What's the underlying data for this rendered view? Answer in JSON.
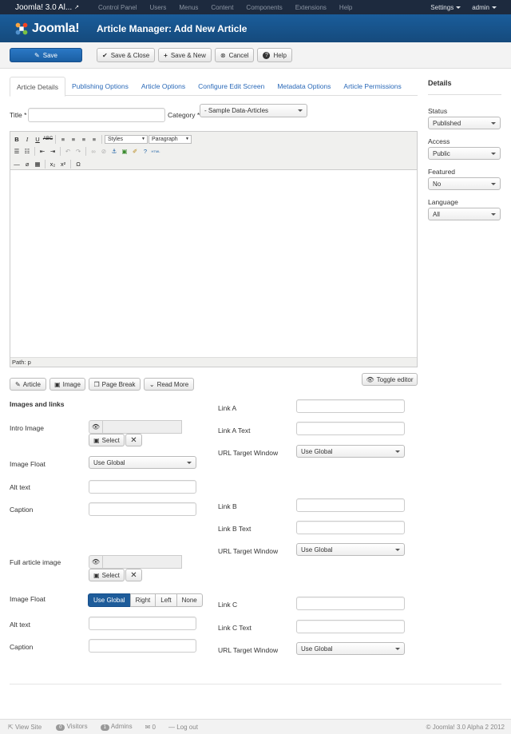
{
  "topbar": {
    "site_name": "Joomla! 3.0 Al...",
    "nav": [
      "Control Panel",
      "Users",
      "Menus",
      "Content",
      "Components",
      "Extensions",
      "Help"
    ],
    "settings": "Settings",
    "user": "admin"
  },
  "header": {
    "logo_text": "Joomla!",
    "title": "Article Manager: Add New Article"
  },
  "toolbar": {
    "save": "Save",
    "save_close": "Save & Close",
    "save_new": "Save & New",
    "cancel": "Cancel",
    "help": "Help"
  },
  "tabs": [
    "Article Details",
    "Publishing Options",
    "Article Options",
    "Configure Edit Screen",
    "Metadata Options",
    "Article Permissions"
  ],
  "form": {
    "title_label": "Title *",
    "title_value": "",
    "category_label": "Category *",
    "category_value": "- Sample Data-Articles"
  },
  "editor": {
    "styles": "Styles",
    "paragraph": "Paragraph",
    "path": "Path: p"
  },
  "editor_buttons": {
    "article": "Article",
    "image": "Image",
    "page_break": "Page Break",
    "read_more": "Read More",
    "toggle": "Toggle editor"
  },
  "images": {
    "section_title": "Images and links",
    "intro_image": "Intro Image",
    "select": "Select",
    "image_float": "Image Float",
    "float_value": "Use Global",
    "alt_text": "Alt text",
    "caption": "Caption",
    "full_image": "Full article image",
    "float_options": [
      "Use Global",
      "Right",
      "Left",
      "None"
    ]
  },
  "links": {
    "link_a": "Link A",
    "link_a_text": "Link A Text",
    "url_target": "URL Target Window",
    "target_value": "Use Global",
    "link_b": "Link B",
    "link_b_text": "Link B Text",
    "link_c": "Link C",
    "link_c_text": "Link C Text"
  },
  "details": {
    "heading": "Details",
    "status_label": "Status",
    "status_value": "Published",
    "access_label": "Access",
    "access_value": "Public",
    "featured_label": "Featured",
    "featured_value": "No",
    "language_label": "Language",
    "language_value": "All"
  },
  "statusbar": {
    "view_site": "View Site",
    "visitors_count": "0",
    "visitors": "Visitors",
    "admins_count": "1",
    "admins": "Admins",
    "messages_count": "0",
    "logout": "Log out",
    "copyright": "© Joomla! 3.0 Alpha 2 2012"
  },
  "colors": {
    "accent": "#1b5fa3",
    "topbar": "#1d2a3e",
    "link": "#2a69b8"
  }
}
